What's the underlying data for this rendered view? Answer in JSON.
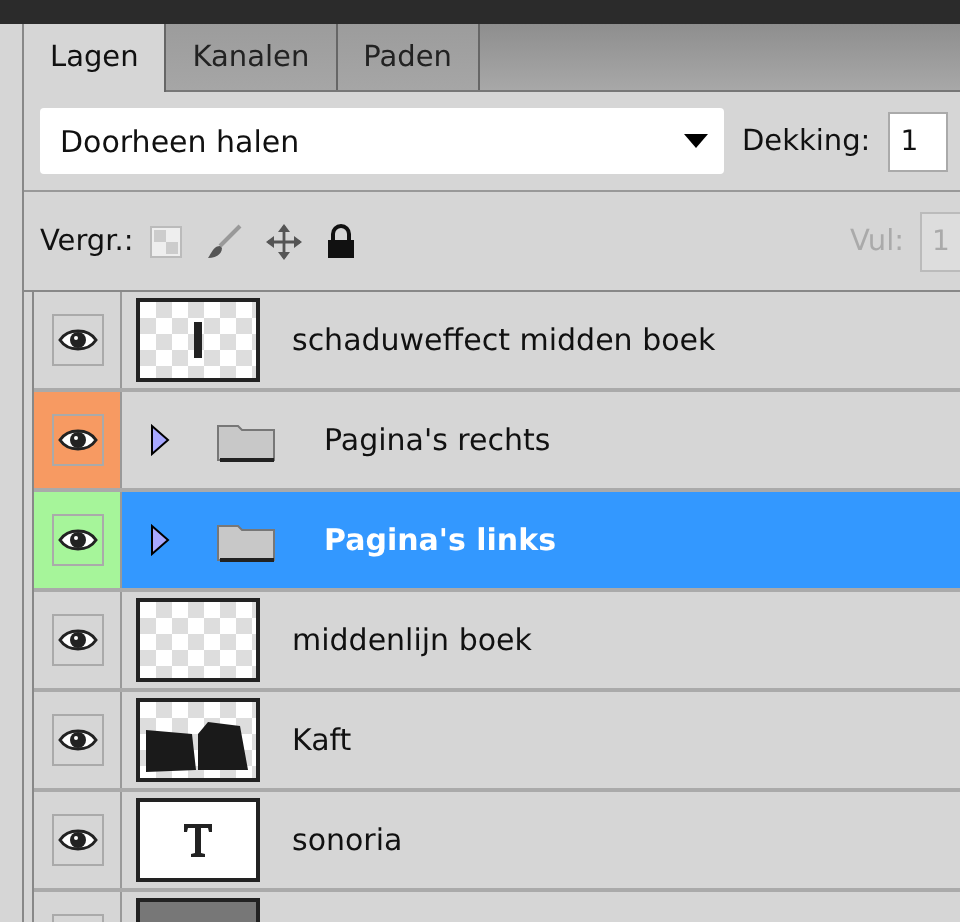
{
  "tabs": [
    {
      "label": "Lagen",
      "selected": true
    },
    {
      "label": "Kanalen",
      "selected": false
    },
    {
      "label": "Paden",
      "selected": false
    }
  ],
  "blend_mode": {
    "value": "Doorheen halen"
  },
  "opacity": {
    "label": "Dekking:",
    "value": "1"
  },
  "lock": {
    "label": "Vergr.:"
  },
  "fill": {
    "label": "Vul:",
    "value": "1",
    "disabled": true
  },
  "layers": [
    {
      "name": "schaduweffect midden boek",
      "kind": "bar",
      "selected": false
    },
    {
      "name": "Pagina's rechts",
      "kind": "group",
      "expanded": false,
      "color": "#f79a62",
      "selected": false
    },
    {
      "name": "Pagina's links",
      "kind": "group",
      "expanded": false,
      "color": "#a6f59a",
      "selected": true
    },
    {
      "name": "middenlijn boek",
      "kind": "empty",
      "selected": false
    },
    {
      "name": "Kaft",
      "kind": "shape",
      "selected": false
    },
    {
      "name": "sonoria",
      "kind": "text",
      "selected": false
    },
    {
      "kind": "dark"
    }
  ]
}
